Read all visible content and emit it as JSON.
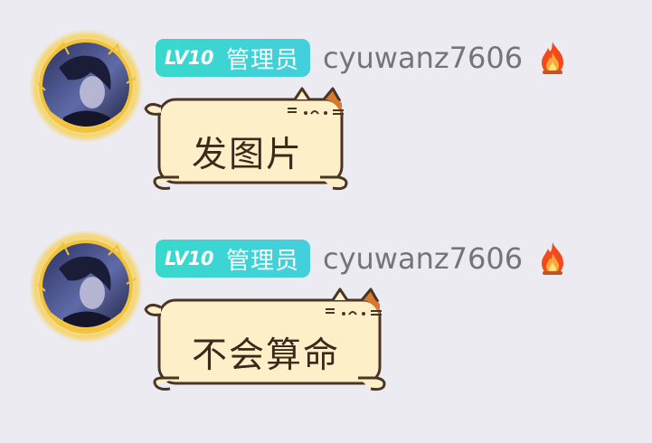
{
  "messages": [
    {
      "sender": {
        "level": "LV10",
        "role": "管理员",
        "username": "cyuwanz7606",
        "status_icon": "fire-icon"
      },
      "text": "发图片",
      "bubble_style": "cat-frame"
    },
    {
      "sender": {
        "level": "LV10",
        "role": "管理员",
        "username": "cyuwanz7606",
        "status_icon": "fire-icon"
      },
      "text": "不会算命",
      "bubble_style": "cat-frame"
    }
  ],
  "colors": {
    "background": "#ecebf2",
    "badge": "#3ed6d2",
    "bubble_fill": "#fdf0c8",
    "bubble_outline": "#4a3524",
    "username": "#75747c",
    "cat_patch": "#d9782f",
    "avatar_frame": "#f3c64a"
  }
}
